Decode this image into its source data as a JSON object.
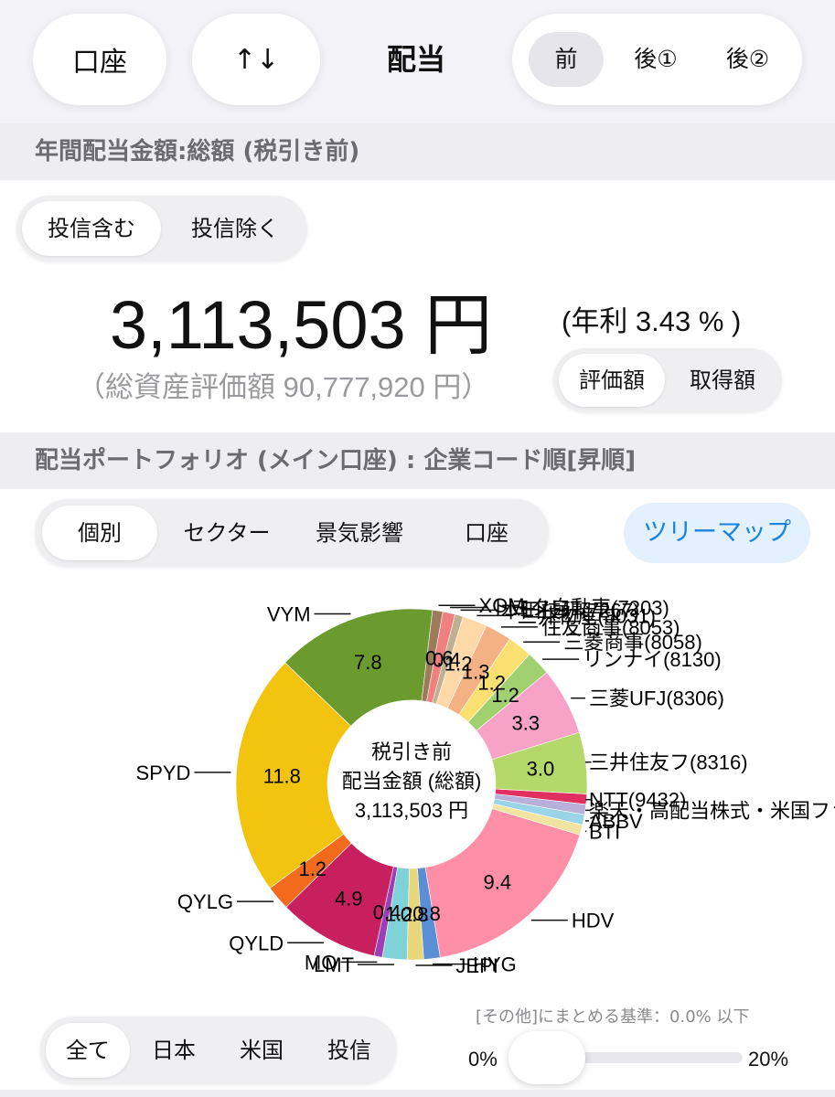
{
  "header": {
    "account_label": "口座",
    "sort_label": "↑↓",
    "title": "配当",
    "timing_options": [
      "前",
      "後①",
      "後②"
    ],
    "timing_selected": "前"
  },
  "annual_section": {
    "header": "年間配当金額:総額 (税引き前)",
    "fund_options": [
      "投信含む",
      "投信除く"
    ],
    "fund_selected": "投信含む",
    "amount": "3,113,503 円",
    "yield_text": "(年利 3.43 % )",
    "total_assets_text": "（総資産評価額 90,777,920 円）",
    "basis_options": [
      "評価額",
      "取得額"
    ],
    "basis_selected": "評価額"
  },
  "portfolio_section": {
    "header": "配当ポートフォリオ (メイン口座) : 企業コード順[昇順]",
    "view_options": [
      "個別",
      "セクター",
      "景気影響",
      "口座"
    ],
    "view_selected": "個別",
    "treemap_label": "ツリーマップ"
  },
  "chart_data": {
    "type": "pie",
    "style": "donut",
    "center_text": [
      "税引き前",
      "配当金額 (総額)",
      "3,113,503 円"
    ],
    "unit": "%",
    "slices": [
      {
        "label": "VYM",
        "value": 7.8,
        "color": "#6b9a2e"
      },
      {
        "label": "SPYD",
        "value": 11.8,
        "color": "#f2c40f"
      },
      {
        "label": "QYLG",
        "value": 1.2,
        "color": "#f26b1d"
      },
      {
        "label": "QYLD",
        "value": 4.9,
        "color": "#c8205e"
      },
      {
        "label": "MO",
        "value": 0.4,
        "color": "#9b3fb5"
      },
      {
        "label": "LMT",
        "value": 1.2,
        "color": "#7fd3d8"
      },
      {
        "label": "JEPI",
        "value": 0.8,
        "color": "#e8d77a"
      },
      {
        "label": "HYG",
        "value": 0.8,
        "color": "#5a8fd6"
      },
      {
        "label": "HDV",
        "value": 9.4,
        "color": "#ff8fa6"
      },
      {
        "label": "BTI",
        "value": null,
        "color": "#f0e4a0"
      },
      {
        "label": "ABBV",
        "value": null,
        "color": "#9ad4e8"
      },
      {
        "label": "楽天・高配当株式・米国ファンド",
        "value": null,
        "color": "#b8b0d8"
      },
      {
        "label": "NTT(9432)",
        "value": null,
        "color": "#e03060"
      },
      {
        "label": "三井住友フ(8316)",
        "value": 3.0,
        "color": "#b5d86a"
      },
      {
        "label": "三菱UFJ(8306)",
        "value": 3.3,
        "color": "#f7a3c8"
      },
      {
        "label": "リンナイ(8130)",
        "value": 1.2,
        "color": "#a0d070"
      },
      {
        "label": "三菱商事(8058)",
        "value": 1.2,
        "color": "#f9e070"
      },
      {
        "label": "住友商事(8053)",
        "value": 1.3,
        "color": "#f4b183"
      },
      {
        "label": "三井物産(8031)",
        "value": 1.2,
        "color": "#ffd8a8"
      },
      {
        "label": "本田技研(7267)",
        "value": 0.4,
        "color": "#c0b090"
      },
      {
        "label": "トヨタ自動車(7203)",
        "value": 0.6,
        "color": "#f08080"
      },
      {
        "label": "XOM",
        "value": null,
        "color": "#9b7b5b"
      }
    ],
    "visible_labels_right": [
      "三菱UFJ(8306)",
      "三井住友フ(8316)",
      "三菱商事(8058)",
      "住友商事(8053)",
      "リンナイ(8130)",
      "三井物産(8031)"
    ],
    "visible_labels_left": [
      "VYM",
      "SPYD",
      "QYLG",
      "QYLD",
      "MO",
      "LMT",
      "JEPI",
      "HYG",
      "HDV",
      "BTI",
      "ABBV",
      "楽天・高配当株式・米国ファンド"
    ]
  },
  "slider": {
    "note": "[その他]にまとめる基準：0.0% 以下",
    "min_label": "0%",
    "max_label": "20%",
    "value_percent": 0
  },
  "filter": {
    "options": [
      "全て",
      "日本",
      "米国",
      "投信"
    ],
    "selected": "全て"
  }
}
